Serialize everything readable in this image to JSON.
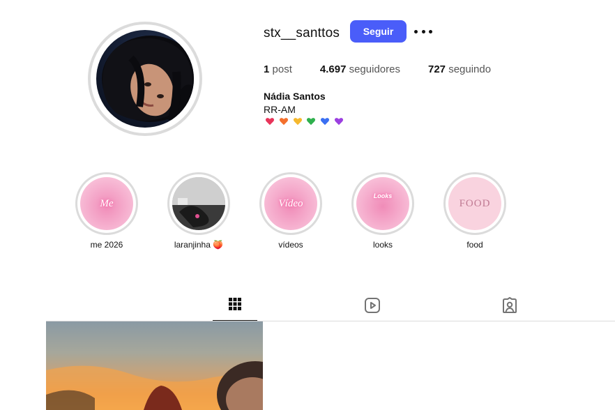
{
  "profile": {
    "username": "stx__santtos",
    "follow_label": "Seguir",
    "more_label": "•••",
    "stats": [
      {
        "count": "1",
        "label": "post"
      },
      {
        "count": "4.697",
        "label": "seguidores"
      },
      {
        "count": "727",
        "label": "seguindo"
      }
    ],
    "full_name": "Nádia Santos",
    "bio": "RR-AM",
    "hearts": [
      "#e8345a",
      "#f4702d",
      "#f5b82e",
      "#2fb04d",
      "#3a6ff2",
      "#9b3fe0"
    ]
  },
  "highlights": [
    {
      "label": "me 2026",
      "cover_text": "Me"
    },
    {
      "label": "laranjinha 🍑",
      "cover_text": ""
    },
    {
      "label": "vídeos",
      "cover_text": "Vídeo"
    },
    {
      "label": "looks",
      "cover_text": "Looks"
    },
    {
      "label": "food",
      "cover_text": "FOOD"
    }
  ],
  "tabs": [
    {
      "name": "posts",
      "icon": "grid-icon",
      "active": true
    },
    {
      "name": "reels",
      "icon": "reels-icon",
      "active": false
    },
    {
      "name": "tagged",
      "icon": "tagged-icon",
      "active": false
    }
  ]
}
